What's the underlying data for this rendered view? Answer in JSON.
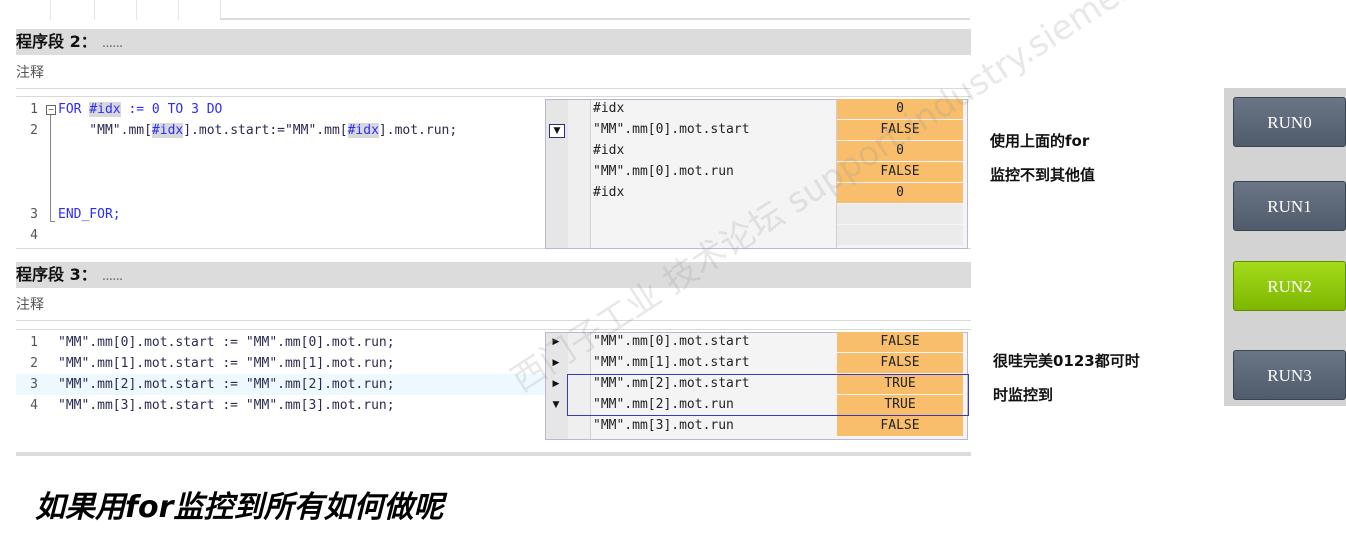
{
  "network2": {
    "title": "程序段 2：",
    "dots": "......",
    "comment": "注释",
    "code_lines": [
      {
        "num": "1",
        "segments": [
          {
            "t": "FOR ",
            "c": "kw"
          },
          {
            "t": "#idx",
            "c": "hl"
          },
          {
            "t": " := 0 TO 3 DO",
            "c": "kw"
          }
        ]
      },
      {
        "num": "2",
        "segments": [
          {
            "t": "    \"MM\".mm[",
            "c": "plain"
          },
          {
            "t": "#idx",
            "c": "hl"
          },
          {
            "t": "].mot.start:=\"MM\".mm[",
            "c": "plain"
          },
          {
            "t": "#idx",
            "c": "hl"
          },
          {
            "t": "].mot.run;",
            "c": "plain"
          }
        ]
      },
      {
        "num": "3",
        "segments": [
          {
            "t": "END_FOR;",
            "c": "kw"
          }
        ]
      },
      {
        "num": "4",
        "segments": []
      }
    ],
    "watch": [
      {
        "name": "#idx",
        "value": "0"
      },
      {
        "name": "\"MM\".mm[0].mot.start",
        "value": "FALSE"
      },
      {
        "name": "#idx",
        "value": "0"
      },
      {
        "name": "\"MM\".mm[0].mot.run",
        "value": "FALSE"
      },
      {
        "name": "#idx",
        "value": "0"
      }
    ]
  },
  "network3": {
    "title": "程序段 3：",
    "dots": "......",
    "comment": "注释",
    "code_lines": [
      {
        "num": "1",
        "text": "\"MM\".mm[0].mot.start := \"MM\".mm[0].mot.run;"
      },
      {
        "num": "2",
        "text": "\"MM\".mm[1].mot.start := \"MM\".mm[1].mot.run;"
      },
      {
        "num": "3",
        "text": "\"MM\".mm[2].mot.start := \"MM\".mm[2].mot.run;"
      },
      {
        "num": "4",
        "text": "\"MM\".mm[3].mot.start := \"MM\".mm[3].mot.run;"
      }
    ],
    "watch": [
      {
        "name": "\"MM\".mm[0].mot.start",
        "value": "FALSE"
      },
      {
        "name": "\"MM\".mm[1].mot.start",
        "value": "FALSE"
      },
      {
        "name": "\"MM\".mm[2].mot.start",
        "value": "TRUE"
      },
      {
        "name": "\"MM\".mm[2].mot.run",
        "value": "TRUE"
      },
      {
        "name": "\"MM\".mm[3].mot.run",
        "value": "FALSE"
      }
    ]
  },
  "notes": {
    "note1_line1": "使用上面的for",
    "note1_line2": "监控不到其他值",
    "note2_line1": "很哇完美0123都可时",
    "note2_line2": "时监控到",
    "question": "如果用for监控到所有如何做呢"
  },
  "hmi": {
    "buttons": [
      {
        "label": "RUN0",
        "active": false
      },
      {
        "label": "RUN1",
        "active": false
      },
      {
        "label": "RUN2",
        "active": true
      },
      {
        "label": "RUN3",
        "active": false
      }
    ],
    "colors": {
      "active": "#8ccb0a",
      "inactive": "#5c6878"
    }
  },
  "watermark": "西门子工业 技术论坛 support.industry.siemens.com/cs"
}
